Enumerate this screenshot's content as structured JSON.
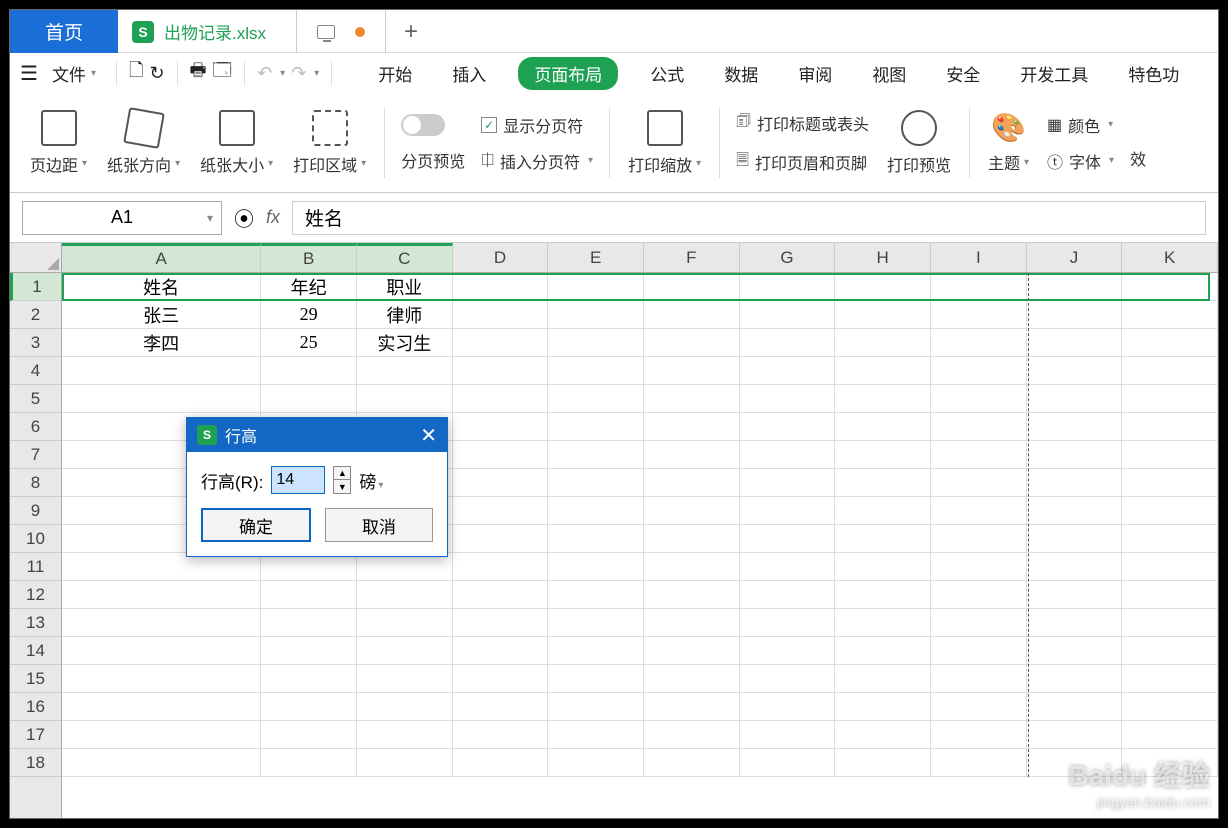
{
  "tabs": {
    "home": "首页",
    "doc": "出物记录.xlsx",
    "docIconLetter": "S",
    "new": "+"
  },
  "menu": {
    "file": "文件",
    "items": [
      "开始",
      "插入",
      "页面布局",
      "公式",
      "数据",
      "审阅",
      "视图",
      "安全",
      "开发工具",
      "特色功"
    ],
    "activeIndex": 2
  },
  "ribbon": {
    "margins": "页边距",
    "orientation": "纸张方向",
    "size": "纸张大小",
    "printArea": "打印区域",
    "pagePreview": "分页预览",
    "showBreaks": "显示分页符",
    "insertBreak": "插入分页符",
    "printScale": "打印缩放",
    "printTitles": "打印标题或表头",
    "printHeaderFooter": "打印页眉和页脚",
    "printPreview": "打印预览",
    "theme": "主题",
    "font": "字体",
    "color": "颜色",
    "effect": "效"
  },
  "namebox": "A1",
  "fx": "fx",
  "formula": "姓名",
  "columns": [
    "A",
    "B",
    "C",
    "D",
    "E",
    "F",
    "G",
    "H",
    "I",
    "J",
    "K"
  ],
  "rows": [
    {
      "n": "1",
      "cells": [
        "姓名",
        "年纪",
        "职业"
      ]
    },
    {
      "n": "2",
      "cells": [
        "张三",
        "29",
        "律师"
      ]
    },
    {
      "n": "3",
      "cells": [
        "李四",
        "25",
        "实习生"
      ]
    },
    {
      "n": "4"
    },
    {
      "n": "5"
    },
    {
      "n": "6"
    },
    {
      "n": "7"
    },
    {
      "n": "8"
    },
    {
      "n": "9"
    },
    {
      "n": "10"
    },
    {
      "n": "11"
    },
    {
      "n": "12"
    },
    {
      "n": "13"
    },
    {
      "n": "14"
    },
    {
      "n": "15"
    },
    {
      "n": "16"
    },
    {
      "n": "17"
    },
    {
      "n": "18"
    }
  ],
  "dialog": {
    "title": "行高",
    "iconLetter": "S",
    "label": "行高(R):",
    "value": "14",
    "unit": "磅",
    "ok": "确定",
    "cancel": "取消"
  },
  "watermark": {
    "brand": "Baidu 经验",
    "sub": "jingyan.baidu.com"
  }
}
